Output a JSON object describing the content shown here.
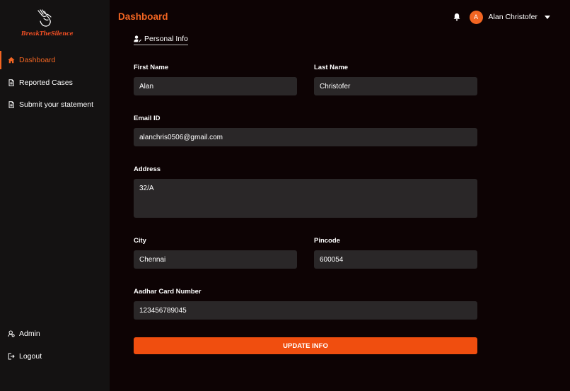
{
  "brand": {
    "logo_text": "BreakTheSilence",
    "accent": "#f26522"
  },
  "sidebar": {
    "items": [
      {
        "label": "Dashboard",
        "icon": "home-icon",
        "active": true
      },
      {
        "label": "Reported Cases",
        "icon": "file-icon",
        "active": false
      },
      {
        "label": "Submit your statement",
        "icon": "file-icon",
        "active": false
      }
    ],
    "bottom_items": [
      {
        "label": "Admin",
        "icon": "admin-icon"
      },
      {
        "label": "Logout",
        "icon": "logout-icon"
      }
    ]
  },
  "header": {
    "title": "Dashboard",
    "user": {
      "initial": "A",
      "name": "Alan Christofer"
    }
  },
  "tab": {
    "label": "Personal Info",
    "icon": "user-edit-icon"
  },
  "form": {
    "first_name": {
      "label": "First Name",
      "value": "Alan"
    },
    "last_name": {
      "label": "Last Name",
      "value": "Christofer"
    },
    "email": {
      "label": "Email ID",
      "value": "alanchris0506@gmail.com"
    },
    "address": {
      "label": "Address",
      "value": "32/A"
    },
    "city": {
      "label": "City",
      "value": "Chennai"
    },
    "pincode": {
      "label": "Pincode",
      "value": "600054"
    },
    "aadhar": {
      "label": "Aadhar Card Number",
      "value": "123456789045"
    },
    "submit_label": "UPDATE INFO"
  }
}
